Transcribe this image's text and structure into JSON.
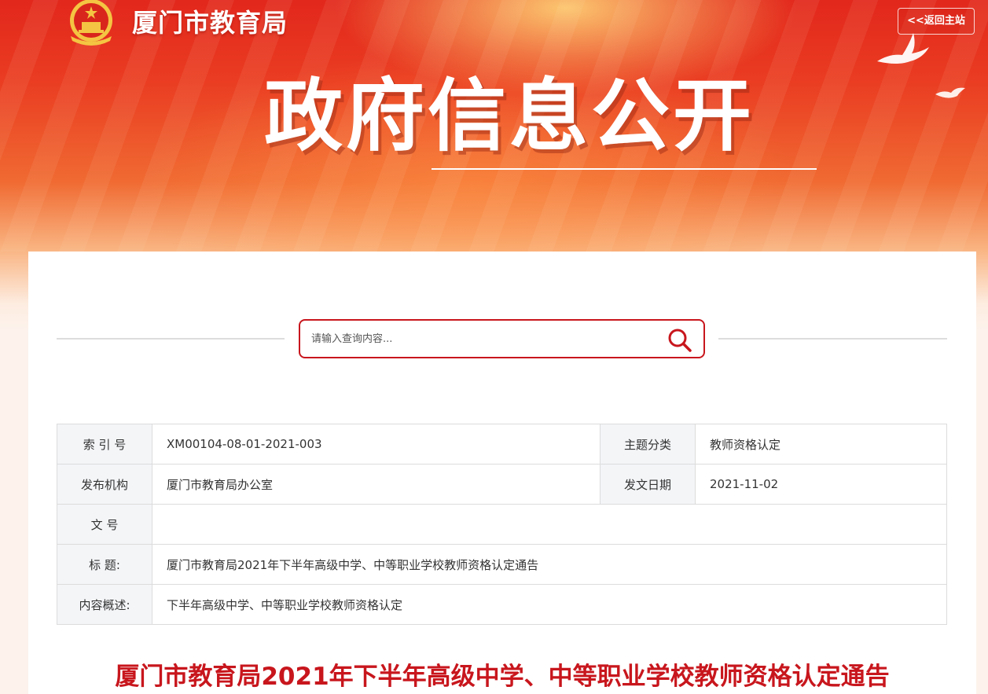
{
  "header": {
    "site_title": "厦门市教育局",
    "back_label": "<<返回主站",
    "banner_title": "政府信息公开"
  },
  "search": {
    "placeholder": "请输入查询内容..."
  },
  "meta": {
    "index_label": "索 引 号",
    "index_value": "XM00104-08-01-2021-003",
    "topic_label": "主题分类",
    "topic_value": "教师资格认定",
    "publisher_label": "发布机构",
    "publisher_value": "厦门市教育局办公室",
    "date_label": "发文日期",
    "date_value": "2021-11-02",
    "docno_label": "文 号",
    "docno_value": "",
    "title_label": "标 题:",
    "title_value": "厦门市教育局2021年下半年高级中学、中等职业学校教师资格认定通告",
    "summary_label": "内容概述:",
    "summary_value": "下半年高级中学、中等职业学校教师资格认定"
  },
  "article": {
    "title": "厦门市教育局2021年下半年高级中学、中等职业学校教师资格认定通告"
  },
  "colors": {
    "accent_red": "#c8161d",
    "banner_red": "#e2271c"
  }
}
